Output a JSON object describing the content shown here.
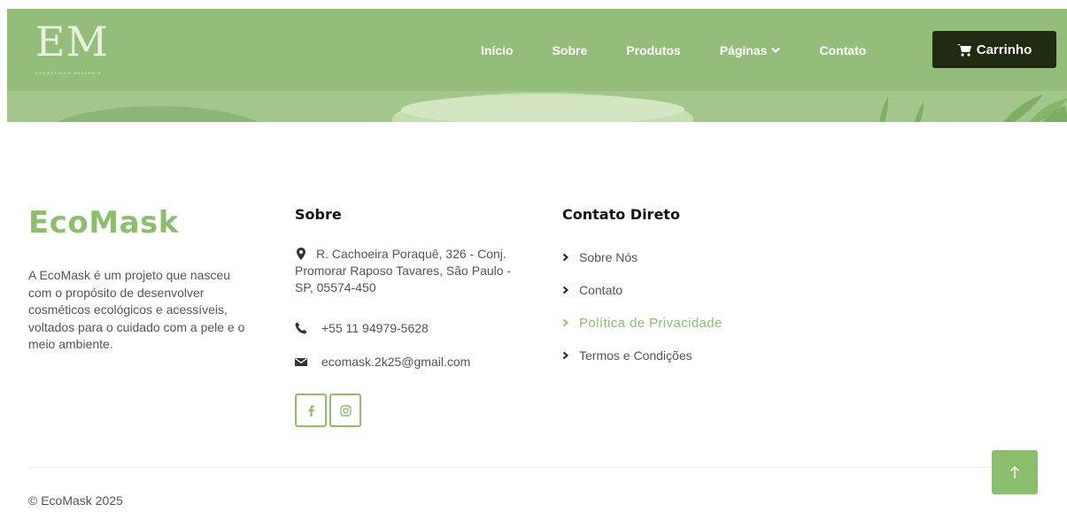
{
  "header": {
    "logo_mark": "EM",
    "logo_subtitle": "COSMÉTICOS NATURAIS",
    "nav": [
      {
        "label": "Início"
      },
      {
        "label": "Sobre"
      },
      {
        "label": "Produtos"
      },
      {
        "label": "Páginas"
      },
      {
        "label": "Contato"
      }
    ],
    "cart_label": "Carrinho"
  },
  "footer": {
    "brand": {
      "title": "EcoMask",
      "description": "A EcoMask é um projeto que nasceu com o propósito de desenvolver cosméticos ecológicos e acessíveis, voltados para o cuidado com a pele e o meio ambiente."
    },
    "sobre": {
      "title": "Sobre",
      "address": "R. Cachoeira Poraquê, 326 - Conj. Promorar Raposo Tavares, São Paulo - SP, 05574-450",
      "phone": "+55 11 94979-5628",
      "email": "ecomask.2k25@gmail.com"
    },
    "contato": {
      "title": "Contato Direto",
      "links": [
        {
          "label": "Sobre Nós"
        },
        {
          "label": "Contato"
        },
        {
          "label": "Política de Privacidade"
        },
        {
          "label": "Termos e Condições"
        }
      ]
    },
    "copyright": "© EcoMask 2025"
  },
  "colors": {
    "header_bg": "#94bd7b",
    "accent": "#8cbf6d",
    "cart_bg": "#1f2a10"
  }
}
